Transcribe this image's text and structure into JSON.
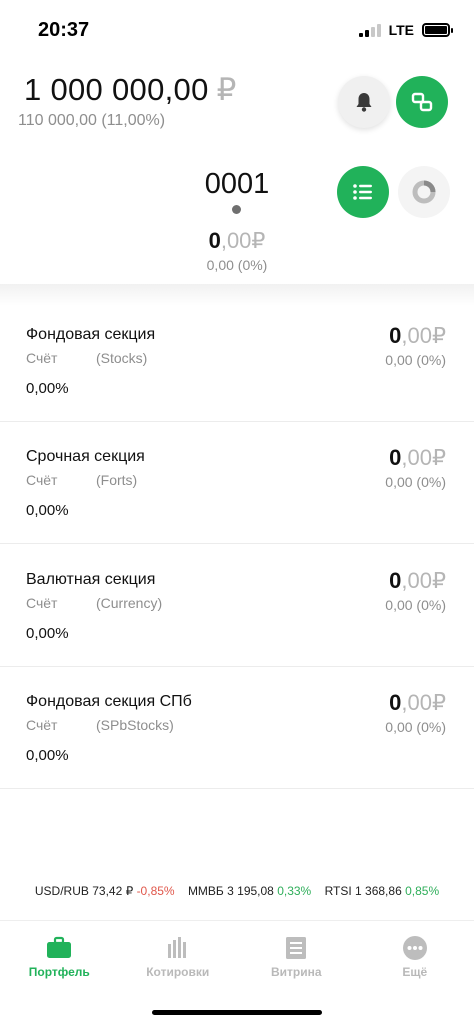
{
  "status_bar": {
    "time": "20:37",
    "network": "LTE"
  },
  "portfolio": {
    "total_value": "1 000 000,00",
    "currency_symbol": "₽",
    "total_change": "110 000,00 (11,00%)"
  },
  "account": {
    "id": "0001",
    "value_int": "0",
    "value_frac": ",00₽",
    "change": "0,00 (0%)"
  },
  "sections": [
    {
      "title": "Фондовая секция",
      "account_label": "Счёт",
      "type": "(Stocks)",
      "percent": "0,00%",
      "value_int": "0",
      "value_frac": ",00₽",
      "change": "0,00 (0%)"
    },
    {
      "title": "Срочная секция",
      "account_label": "Счёт",
      "type": "(Forts)",
      "percent": "0,00%",
      "value_int": "0",
      "value_frac": ",00₽",
      "change": "0,00 (0%)"
    },
    {
      "title": "Валютная секция",
      "account_label": "Счёт",
      "type": "(Currency)",
      "percent": "0,00%",
      "value_int": "0",
      "value_frac": ",00₽",
      "change": "0,00 (0%)"
    },
    {
      "title": "Фондовая секция СПб",
      "account_label": "Счёт",
      "type": "(SPbStocks)",
      "percent": "0,00%",
      "value_int": "0",
      "value_frac": ",00₽",
      "change": "0,00 (0%)"
    }
  ],
  "ticker": [
    {
      "label": "USD/RUB 73,42 ₽",
      "change": "-0,85%",
      "direction": "down"
    },
    {
      "label": "ММВБ 3 195,08",
      "change": "0,33%",
      "direction": "up"
    },
    {
      "label": "RTSI 1 368,86",
      "change": "0,85%",
      "direction": "up"
    }
  ],
  "tabs": [
    {
      "label": "Портфель",
      "icon": "briefcase-icon",
      "active": true
    },
    {
      "label": "Котировки",
      "icon": "bar-chart-icon",
      "active": false
    },
    {
      "label": "Витрина",
      "icon": "document-icon",
      "active": false
    },
    {
      "label": "Ещё",
      "icon": "more-icon",
      "active": false
    }
  ],
  "colors": {
    "accent": "#21b25a",
    "negative": "#e0574b",
    "positive": "#2fae5a",
    "muted": "#8e8e8e"
  }
}
